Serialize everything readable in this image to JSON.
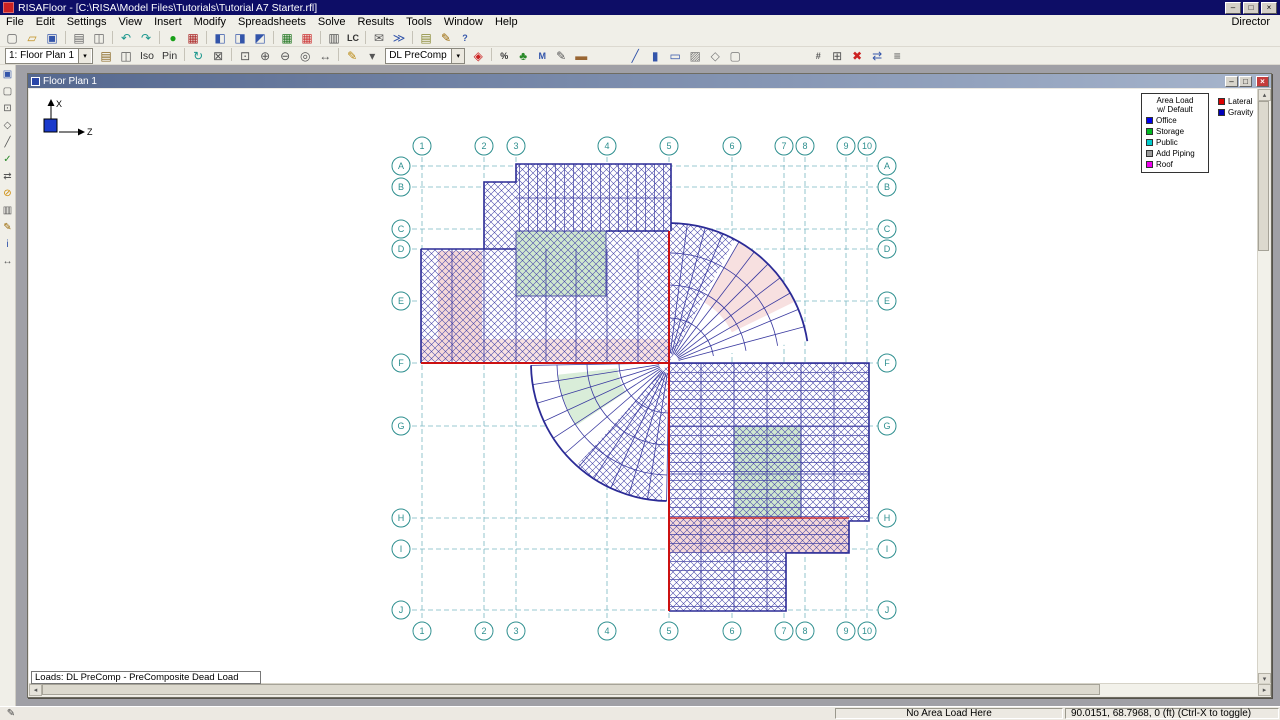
{
  "titlebar": {
    "title": "RISAFloor - [C:\\RISA\\Model Files\\Tutorials\\Tutorial A7 Starter.rfl]",
    "minimize": "–",
    "maximize": "□",
    "close": "×"
  },
  "menubar": {
    "items": [
      "File",
      "Edit",
      "Settings",
      "View",
      "Insert",
      "Modify",
      "Spreadsheets",
      "Solve",
      "Results",
      "Tools",
      "Window",
      "Help"
    ],
    "right_item": "Director"
  },
  "glyphs": {
    "dropdown_arrow": "▾",
    "scroll_left": "◂",
    "scroll_right": "▸",
    "scroll_up": "▴",
    "scroll_down": "▾",
    "status_icon": "✎"
  },
  "toolbar_main": {
    "icons": [
      {
        "name": "new-model",
        "glyph": "▢",
        "color": "#666"
      },
      {
        "name": "open-file",
        "glyph": "▱",
        "color": "#c09020"
      },
      {
        "name": "save-file",
        "glyph": "▣",
        "color": "#3355aa"
      },
      {
        "sep": true
      },
      {
        "name": "print",
        "glyph": "▤",
        "color": "#666"
      },
      {
        "name": "print-preview",
        "glyph": "◫",
        "color": "#666"
      },
      {
        "sep": true
      },
      {
        "name": "undo",
        "glyph": "↶",
        "color": "#18968c"
      },
      {
        "name": "redo",
        "glyph": "↷",
        "color": "#18968c"
      },
      {
        "sep": true
      },
      {
        "name": "solve",
        "glyph": "●",
        "color": "#18a018"
      },
      {
        "name": "results",
        "glyph": "▦",
        "color": "#aa2222"
      },
      {
        "sep": true
      },
      {
        "name": "graphic-view",
        "glyph": "◧",
        "color": "#3355aa"
      },
      {
        "name": "rendered-view",
        "glyph": "◨",
        "color": "#3355aa"
      },
      {
        "name": "plan-view",
        "glyph": "◩",
        "color": "#3355aa"
      },
      {
        "sep": true
      },
      {
        "name": "data-entry-grid",
        "glyph": "▦",
        "color": "#227722"
      },
      {
        "name": "loads-spreadsheet",
        "glyph": "▦",
        "color": "#cc3333"
      },
      {
        "sep": true
      },
      {
        "name": "spreadsheets",
        "glyph": "▥",
        "color": "#555"
      },
      {
        "name": "load-combinations",
        "glyph": "LC",
        "color": "#333",
        "text": true
      },
      {
        "sep": true
      },
      {
        "name": "envelope-solve",
        "glyph": "✉",
        "color": "#555"
      },
      {
        "name": "batch-solve",
        "glyph": "≫",
        "color": "#3355aa"
      },
      {
        "sep": true
      },
      {
        "name": "notes",
        "glyph": "▤",
        "color": "#888833"
      },
      {
        "name": "engineering-tools",
        "glyph": "✎",
        "color": "#996600"
      },
      {
        "name": "help",
        "glyph": "?",
        "color": "#3355aa",
        "text": true
      }
    ]
  },
  "toolbar_view": {
    "floor_selector": "1: Floor Plan 1",
    "load_selector": "DL PreComp - Pr",
    "iso_label": "Iso",
    "pin_label": "Pin",
    "icons_a": [
      {
        "name": "floor-properties",
        "glyph": "▤",
        "color": "#886622"
      },
      {
        "name": "view-settings",
        "glyph": "◫",
        "color": "#555"
      }
    ],
    "icons_b": [
      {
        "sep": true
      },
      {
        "name": "redraw",
        "glyph": "↻",
        "color": "#18968c"
      },
      {
        "name": "selection-box",
        "glyph": "⊠",
        "color": "#555"
      },
      {
        "sep": true
      },
      {
        "name": "zoom-box",
        "glyph": "⊡",
        "color": "#555"
      },
      {
        "name": "zoom-in",
        "glyph": "⊕",
        "color": "#555"
      },
      {
        "name": "zoom-out",
        "glyph": "⊖",
        "color": "#555"
      },
      {
        "name": "zoom-extents",
        "glyph": "◎",
        "color": "#555"
      },
      {
        "name": "pan",
        "glyph": "↔",
        "color": "#555"
      },
      {
        "sep": true
      },
      {
        "name": "edit-drawing",
        "glyph": "✎",
        "color": "#b8860b"
      },
      {
        "name": "edit-drawing-dropdown",
        "glyph": "▾",
        "color": "#555"
      }
    ],
    "icons_c": [
      {
        "name": "load-direction",
        "glyph": "◈",
        "color": "#cc2222"
      },
      {
        "sep": true
      },
      {
        "name": "percent-open",
        "glyph": "%",
        "color": "#333",
        "text": true
      },
      {
        "name": "render-model",
        "glyph": "♣",
        "color": "#2a8a2a"
      },
      {
        "name": "moment-display",
        "glyph": "M",
        "color": "#3355aa",
        "text": true
      },
      {
        "name": "modify-properties",
        "glyph": "✎",
        "color": "#555"
      },
      {
        "name": "paint-deck",
        "glyph": "▬",
        "color": "#996633"
      },
      {
        "gap": 34
      },
      {
        "name": "draw-beams",
        "glyph": "╱",
        "color": "#3355aa"
      },
      {
        "name": "draw-columns",
        "glyph": "▮",
        "color": "#3355aa"
      },
      {
        "name": "draw-walls",
        "glyph": "▭",
        "color": "#3355aa"
      },
      {
        "name": "draw-deck",
        "glyph": "▨",
        "color": "#777"
      },
      {
        "name": "draw-slab-edge",
        "glyph": "◇",
        "color": "#777"
      },
      {
        "name": "draw-opening",
        "glyph": "▢",
        "color": "#777"
      },
      {
        "gap": 64
      },
      {
        "name": "snap-settings",
        "glyph": "#",
        "color": "#555",
        "text": true
      },
      {
        "name": "grid-settings",
        "glyph": "⊞",
        "color": "#555"
      },
      {
        "name": "delete-items",
        "glyph": "✖",
        "color": "#cc2222"
      },
      {
        "name": "move-items",
        "glyph": "⇄",
        "color": "#3355aa"
      },
      {
        "name": "view-options",
        "glyph": "≡",
        "color": "#555"
      }
    ]
  },
  "side_toolbar": {
    "icons": [
      {
        "name": "select-all",
        "glyph": "▣",
        "color": "#3355aa"
      },
      {
        "name": "unselect-all",
        "glyph": "▢",
        "color": "#555"
      },
      {
        "name": "box-select",
        "glyph": "⊡",
        "color": "#555"
      },
      {
        "name": "polygon-select",
        "glyph": "◇",
        "color": "#555"
      },
      {
        "name": "line-select",
        "glyph": "╱",
        "color": "#555"
      },
      {
        "name": "criteria-select",
        "glyph": "✓",
        "color": "#2a8a2a"
      },
      {
        "name": "invert-selection",
        "glyph": "⇄",
        "color": "#555"
      },
      {
        "name": "lock-unselected",
        "glyph": "⊘",
        "color": "#cc8800"
      },
      {
        "name": "save-selection",
        "glyph": "▥",
        "color": "#555"
      },
      {
        "name": "graphic-editing",
        "glyph": "✎",
        "color": "#996600"
      },
      {
        "name": "information",
        "glyph": "i",
        "color": "#3355aa",
        "text": true
      },
      {
        "name": "measure-tool",
        "glyph": "↔",
        "color": "#555"
      }
    ]
  },
  "floor_window": {
    "title": "Floor Plan 1",
    "minimize": "–",
    "maximize": "□",
    "close": "×",
    "loads_label": "Loads: DL PreComp - PreComposite Dead Load"
  },
  "plan": {
    "grid": {
      "columns": [
        "1",
        "2",
        "3",
        "4",
        "5",
        "6",
        "7",
        "8",
        "9",
        "10"
      ],
      "rows": [
        "A",
        "B",
        "C",
        "D",
        "E",
        "F",
        "G",
        "H",
        "I",
        "J"
      ]
    },
    "axis": {
      "x_label": "X",
      "z_label": "Z"
    }
  },
  "legend": {
    "title_line1": "Area Load",
    "title_line2": "w/ Default",
    "items": [
      {
        "label": "Office",
        "color": "#0000ee"
      },
      {
        "label": "Storage",
        "color": "#00bb22"
      },
      {
        "label": "Public",
        "color": "#00cccc"
      },
      {
        "label": "Add Piping",
        "color": "#9a9a9a"
      },
      {
        "label": "Roof",
        "color": "#ee00ee"
      }
    ],
    "direction_items": [
      {
        "label": "Lateral",
        "color": "#dd0000"
      },
      {
        "label": "Gravity",
        "color": "#0000bb"
      }
    ]
  },
  "statusbar": {
    "hint": "No Area Load Here",
    "coords": "90.0151, 68.7968, 0 (ft)  (Ctrl-X to toggle)"
  }
}
